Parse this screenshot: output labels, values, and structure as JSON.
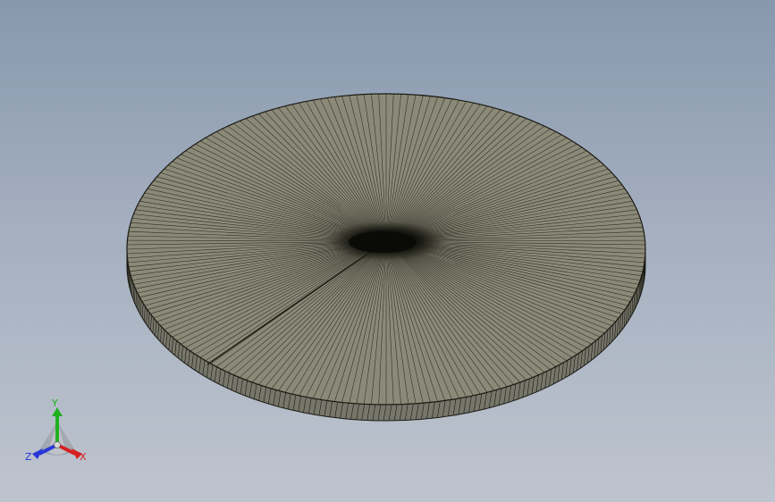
{
  "viewport": {
    "background_top": "#8798ae",
    "background_bottom": "#bec4cf"
  },
  "model": {
    "shape": "disk",
    "face_color": "#8b8a78",
    "edge_color": "#1a1a14",
    "side_color": "#77766a",
    "segments": 220
  },
  "triad": {
    "x_label": "X",
    "y_label": "Y",
    "z_label": "Z",
    "x_color": "#d42020",
    "y_color": "#1fb11f",
    "z_color": "#2a36d8"
  }
}
